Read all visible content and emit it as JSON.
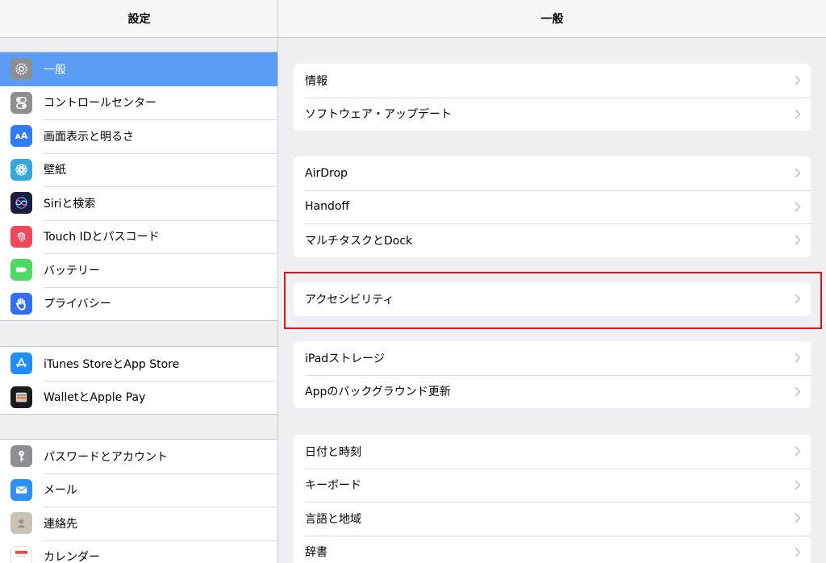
{
  "sidebar": {
    "title": "設定",
    "groups": [
      [
        {
          "label": "一般",
          "icon": "gear-icon",
          "color": "#8e8e93",
          "selected": true
        },
        {
          "label": "コントロールセンター",
          "icon": "toggle-icon",
          "color": "#8e8e93"
        },
        {
          "label": "画面表示と明るさ",
          "icon": "text-size-icon",
          "color": "#2f7cf6"
        },
        {
          "label": "壁紙",
          "icon": "flower-icon",
          "color": "#34aadc"
        },
        {
          "label": "Siriと検索",
          "icon": "siri-icon",
          "color": "#1c1c3c"
        },
        {
          "label": "Touch IDとパスコード",
          "icon": "fingerprint-icon",
          "color": "#f0475d"
        },
        {
          "label": "バッテリー",
          "icon": "battery-icon",
          "color": "#4cd964"
        },
        {
          "label": "プライバシー",
          "icon": "hand-icon",
          "color": "#2f6ff0"
        }
      ],
      [
        {
          "label": "iTunes StoreとApp Store",
          "icon": "app-store-icon",
          "color": "#1f8ff5"
        },
        {
          "label": "WalletとApple Pay",
          "icon": "wallet-icon",
          "color": "#1c1c1c"
        }
      ],
      [
        {
          "label": "パスワードとアカウント",
          "icon": "key-icon",
          "color": "#8e8e93"
        },
        {
          "label": "メール",
          "icon": "mail-icon",
          "color": "#2f8ff5"
        },
        {
          "label": "連絡先",
          "icon": "contacts-icon",
          "color": "#c9c2b5"
        },
        {
          "label": "カレンダー",
          "icon": "calendar-icon",
          "color": "#ffffff"
        }
      ]
    ]
  },
  "detail": {
    "title": "一般",
    "groups": [
      [
        "情報",
        "ソフトウェア・アップデート"
      ],
      [
        "AirDrop",
        "Handoff",
        "マルチタスクとDock"
      ],
      [
        "アクセシビリティ"
      ],
      [
        "iPadストレージ",
        "Appのバックグラウンド更新"
      ],
      [
        "日付と時刻",
        "キーボード",
        "言語と地域",
        "辞書"
      ]
    ]
  },
  "colors": {
    "selected": "#5a9cf6",
    "highlight": "#e5141b"
  }
}
